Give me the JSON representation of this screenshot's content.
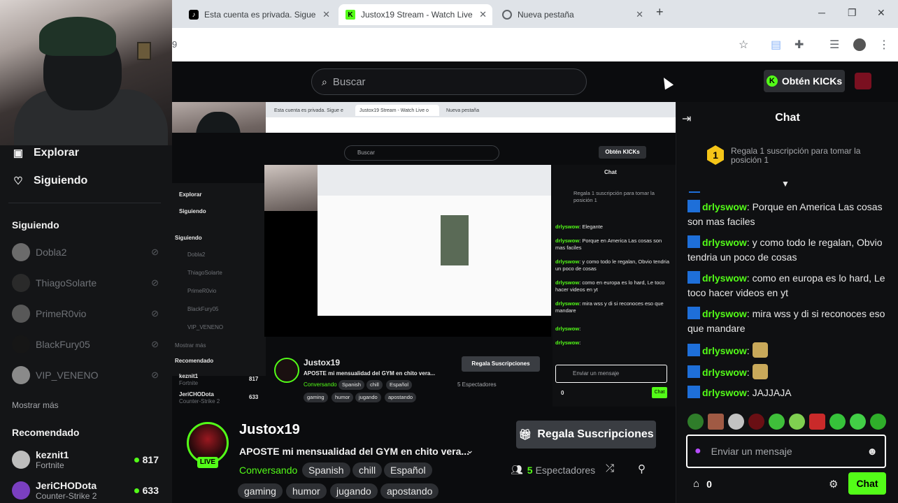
{
  "browser": {
    "tabs": [
      {
        "label": "Esta cuenta es privada. Sigue e",
        "icon": "tiktok-icon"
      },
      {
        "label": "Justox19 Stream - Watch Live o",
        "icon": "kick-icon"
      },
      {
        "label": "Nueva pestaña",
        "icon": "chrome-icon"
      }
    ],
    "address_fragment": "9",
    "new_tab": "+",
    "close": "✕"
  },
  "header": {
    "search_placeholder": "Buscar",
    "kicks_label": "Obtén KICKs",
    "kicks_icon": "K"
  },
  "sidebar": {
    "nav": [
      {
        "label": "Explorar",
        "icon": "compass-icon"
      },
      {
        "label": "Siguiendo",
        "icon": "heart-icon"
      }
    ],
    "following_heading": "Siguiendo",
    "following": [
      {
        "name": "Dobla2"
      },
      {
        "name": "ThiagoSolarte"
      },
      {
        "name": "PrimeR0vio"
      },
      {
        "name": "BlackFury05"
      },
      {
        "name": "VIP_VENENO"
      }
    ],
    "show_more": "Mostrar más",
    "recommended_heading": "Recomendado",
    "recommended": [
      {
        "name": "keznit1",
        "game": "Fortnite",
        "viewers": "817",
        "color": "#bdbdbd"
      },
      {
        "name": "JeriCHODota",
        "game": "Counter-Strike 2",
        "viewers": "633",
        "color": "#7a3fc0"
      }
    ]
  },
  "stream": {
    "streamer": "Justox19",
    "live_badge": "LIVE",
    "title": "APOSTE mi mensualidad del GYM en chito vera...",
    "category": "Conversando",
    "tags": [
      "Spanish",
      "chill",
      "Español",
      "gaming",
      "humor",
      "jugando",
      "apostando"
    ],
    "gift_label": "Regala Suscripciones",
    "viewer_count": "5",
    "viewer_label": "Espectadores"
  },
  "chat": {
    "title": "Chat",
    "pinned_badge": "1",
    "pinned_text": "Regala 1 suscripción para tomar la posición 1",
    "messages": [
      {
        "user": "drlyswow",
        "text": "Porque en America Las cosas son mas faciles"
      },
      {
        "user": "drlyswow",
        "text": "y como todo le regalan, Obvio tendria un poco de cosas"
      },
      {
        "user": "drlyswow",
        "text": "como en europa es lo hard, Le toco hacer videos en yt"
      },
      {
        "user": "drlyswow",
        "text": "mira wss y di si reconoces eso que mandare"
      },
      {
        "user": "drlyswow",
        "text": ""
      },
      {
        "user": "drlyswow",
        "text": ""
      },
      {
        "user": "drlyswow",
        "text": "JAJJAJA"
      }
    ],
    "separator": ":",
    "input_placeholder": "Enviar un mensaje",
    "kicks_count": "0",
    "send_label": "Chat"
  },
  "nested": {
    "tab1": "Esta cuenta es privada. Sigue e",
    "tab2": "Justox19 Stream - Watch Live o",
    "tab3": "Nueva pestaña",
    "search": "Buscar",
    "kicks": "Obtén KICKs",
    "explorar": "Explorar",
    "siguiendo": "Siguiendo",
    "sig_heading": "Siguiendo",
    "f1": "Dobla2",
    "f2": "ThiagoSolarte",
    "f3": "PrimeR0vio",
    "f4": "BlackFury05",
    "f5": "VIP_VENENO",
    "more": "Mostrar más",
    "rec": "Recomendado",
    "r1": "keznit1",
    "r1g": "Fortnite",
    "r1v": "817",
    "r2": "JeriCHODota",
    "r2g": "Counter-Strike 2",
    "r2v": "633",
    "chat_title": "Chat",
    "pinned": "Regala 1 suscripción para tomar la posición 1",
    "m0u": "drlyswow",
    "m0": "Elegante",
    "m1": "Porque en America Las cosas son mas faciles",
    "m2": "y como todo le regalan, Obvio tendria un poco de cosas",
    "m3": "como en europa es lo hard, Le toco hacer videos en yt",
    "m4": "mira wss y di si reconoces eso que mandare",
    "streamer": "Justox19",
    "title": "APOSTE mi mensualidad del GYM en chito vera...",
    "category": "Conversando",
    "tags": [
      "Spanish",
      "chill",
      "Español",
      "gaming",
      "humor",
      "jugando",
      "apostando"
    ],
    "gift": "Regala Suscripciones",
    "viewers": "5 Espectadores",
    "input": "Enviar un mensaje",
    "zero": "0",
    "send": "Chat"
  }
}
